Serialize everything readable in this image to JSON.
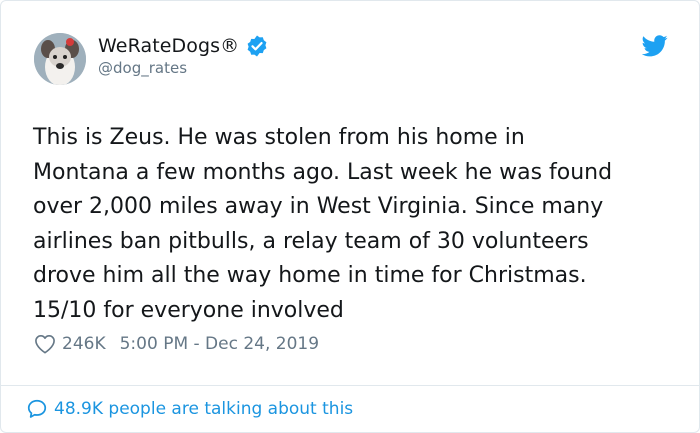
{
  "author": {
    "display_name": "WeRateDogs®",
    "handle": "@dog_rates",
    "verified_icon": "verified-badge-icon"
  },
  "tweet": {
    "text": "This is Zeus. He was stolen from his home in\nMontana a few months ago. Last week he was found\nover 2,000 miles away in West Virginia. Since many\nairlines ban pitbulls, a relay team of 30 volunteers\ndrove him all the way home in time for Christmas.\n15/10 for everyone involved",
    "likes": "246K",
    "timestamp": "5:00 PM - Dec 24, 2019"
  },
  "footer": {
    "talking_label": "48.9K people are talking about this"
  },
  "colors": {
    "accent": "#1da1f2",
    "link": "#1b95e0",
    "muted": "#657786",
    "border": "#e1e8ed"
  }
}
